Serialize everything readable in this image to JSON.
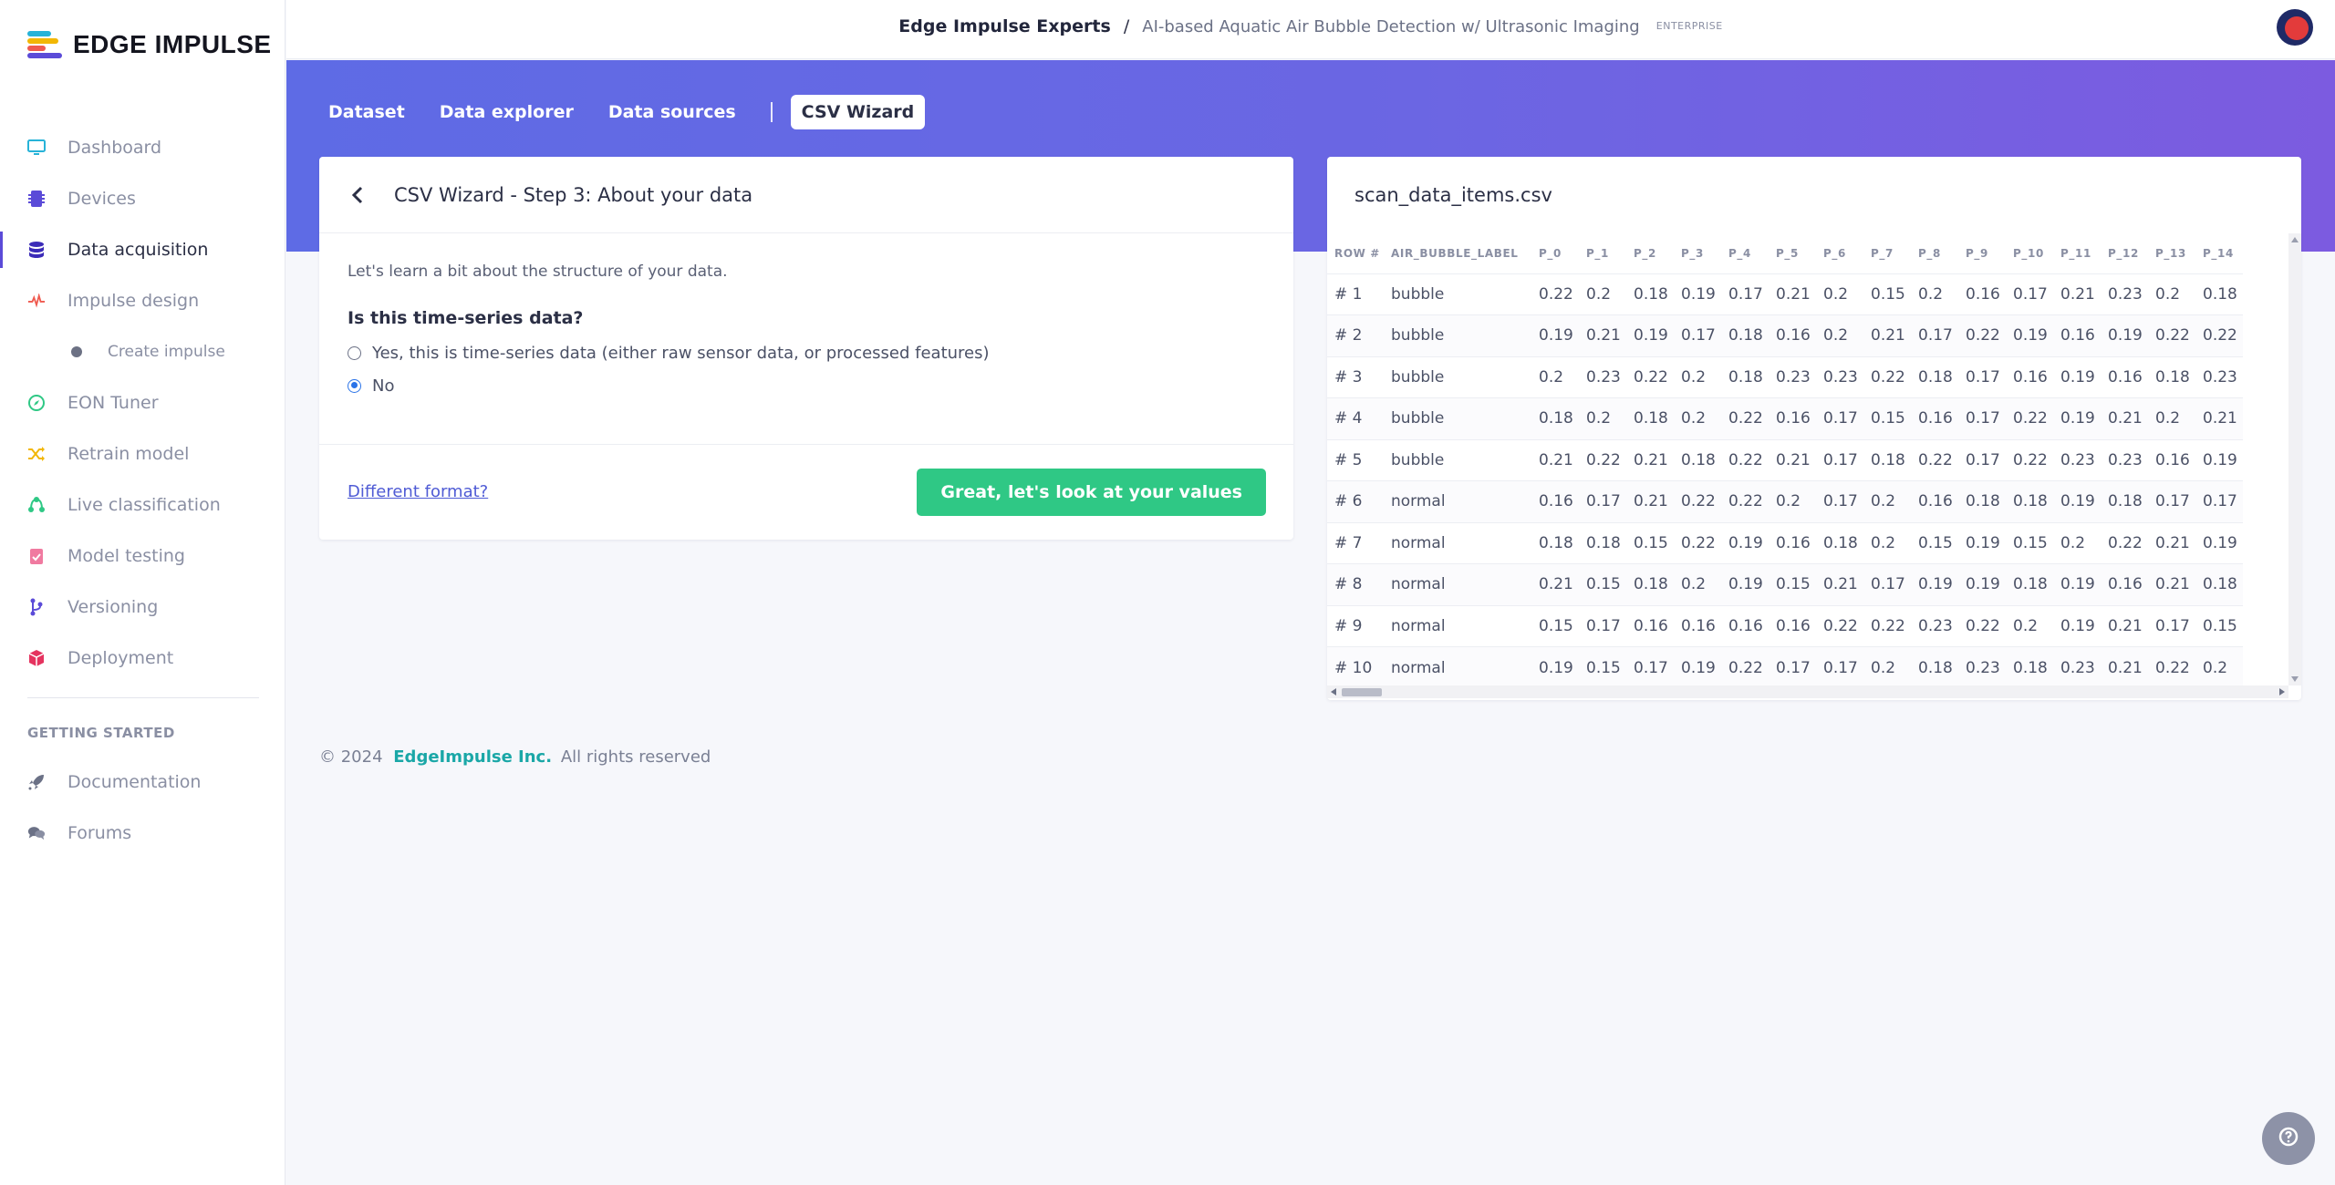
{
  "brand": {
    "name": "EDGE IMPULSE"
  },
  "sidebar": {
    "items": [
      {
        "label": "Dashboard",
        "icon": "monitor-icon",
        "color": "#27b3d8"
      },
      {
        "label": "Devices",
        "icon": "chip-icon",
        "color": "#5b4bd8"
      },
      {
        "label": "Data acquisition",
        "icon": "database-icon",
        "color": "#5b4bd8",
        "active": true
      },
      {
        "label": "Impulse design",
        "icon": "pulse-icon",
        "color": "#ef5a4f"
      },
      {
        "label": "EON Tuner",
        "icon": "compass-icon",
        "color": "#2fc885"
      },
      {
        "label": "Retrain model",
        "icon": "shuffle-icon",
        "color": "#f2b705"
      },
      {
        "label": "Live classification",
        "icon": "nodes-icon",
        "color": "#2fc885"
      },
      {
        "label": "Model testing",
        "icon": "clipboard-check-icon",
        "color": "#f07aa0"
      },
      {
        "label": "Versioning",
        "icon": "branch-icon",
        "color": "#5b4bd8"
      },
      {
        "label": "Deployment",
        "icon": "package-icon",
        "color": "#e5335f"
      }
    ],
    "sub_item": "Create impulse",
    "section_heading": "GETTING STARTED",
    "getting_started": [
      {
        "label": "Documentation",
        "icon": "rocket-icon"
      },
      {
        "label": "Forums",
        "icon": "chat-icon"
      }
    ]
  },
  "header": {
    "org": "Edge Impulse Experts",
    "separator": "/",
    "project": "AI-based Aquatic Air Bubble Detection w/ Ultrasonic Imaging",
    "badge": "ENTERPRISE"
  },
  "tabs": [
    "Dataset",
    "Data explorer",
    "Data sources",
    "CSV Wizard"
  ],
  "wizard": {
    "title": "CSV Wizard - Step 3: About your data",
    "intro": "Let's learn a bit about the structure of your data.",
    "question": "Is this time-series data?",
    "option_yes": "Yes, this is time-series data (either raw sensor data, or processed features)",
    "option_no": "No",
    "selected": "No",
    "different_format": "Different format?",
    "next_button": "Great, let's look at your values"
  },
  "preview": {
    "filename": "scan_data_items.csv",
    "columns": [
      "ROW #",
      "AIR_BUBBLE_LABEL",
      "P_0",
      "P_1",
      "P_2",
      "P_3",
      "P_4",
      "P_5",
      "P_6",
      "P_7",
      "P_8",
      "P_9",
      "P_10",
      "P_11",
      "P_12",
      "P_13",
      "P_14"
    ],
    "rows": [
      [
        "# 1",
        "bubble",
        "0.22",
        "0.2",
        "0.18",
        "0.19",
        "0.17",
        "0.21",
        "0.2",
        "0.15",
        "0.2",
        "0.16",
        "0.17",
        "0.21",
        "0.23",
        "0.2",
        "0.18"
      ],
      [
        "# 2",
        "bubble",
        "0.19",
        "0.21",
        "0.19",
        "0.17",
        "0.18",
        "0.16",
        "0.2",
        "0.21",
        "0.17",
        "0.22",
        "0.19",
        "0.16",
        "0.19",
        "0.22",
        "0.22"
      ],
      [
        "# 3",
        "bubble",
        "0.2",
        "0.23",
        "0.22",
        "0.2",
        "0.18",
        "0.23",
        "0.23",
        "0.22",
        "0.18",
        "0.17",
        "0.16",
        "0.19",
        "0.16",
        "0.18",
        "0.23"
      ],
      [
        "# 4",
        "bubble",
        "0.18",
        "0.2",
        "0.18",
        "0.2",
        "0.22",
        "0.16",
        "0.17",
        "0.15",
        "0.16",
        "0.17",
        "0.22",
        "0.19",
        "0.21",
        "0.2",
        "0.21"
      ],
      [
        "# 5",
        "bubble",
        "0.21",
        "0.22",
        "0.21",
        "0.18",
        "0.22",
        "0.21",
        "0.17",
        "0.18",
        "0.22",
        "0.17",
        "0.22",
        "0.23",
        "0.23",
        "0.16",
        "0.19"
      ],
      [
        "# 6",
        "normal",
        "0.16",
        "0.17",
        "0.21",
        "0.22",
        "0.22",
        "0.2",
        "0.17",
        "0.2",
        "0.16",
        "0.18",
        "0.18",
        "0.19",
        "0.18",
        "0.17",
        "0.17"
      ],
      [
        "# 7",
        "normal",
        "0.18",
        "0.18",
        "0.15",
        "0.22",
        "0.19",
        "0.16",
        "0.18",
        "0.2",
        "0.15",
        "0.19",
        "0.15",
        "0.2",
        "0.22",
        "0.21",
        "0.19"
      ],
      [
        "# 8",
        "normal",
        "0.21",
        "0.15",
        "0.18",
        "0.2",
        "0.19",
        "0.15",
        "0.21",
        "0.17",
        "0.19",
        "0.19",
        "0.18",
        "0.19",
        "0.16",
        "0.21",
        "0.18"
      ],
      [
        "# 9",
        "normal",
        "0.15",
        "0.17",
        "0.16",
        "0.16",
        "0.16",
        "0.16",
        "0.22",
        "0.22",
        "0.23",
        "0.22",
        "0.2",
        "0.19",
        "0.21",
        "0.17",
        "0.15"
      ],
      [
        "# 10",
        "normal",
        "0.19",
        "0.15",
        "0.17",
        "0.19",
        "0.22",
        "0.17",
        "0.17",
        "0.2",
        "0.18",
        "0.23",
        "0.18",
        "0.23",
        "0.21",
        "0.22",
        "0.2"
      ]
    ]
  },
  "footer": {
    "copyright": "© 2024",
    "company": "EdgeImpulse Inc.",
    "rights": "All rights reserved"
  },
  "colors": {
    "accent": "#5b4bd8",
    "primary_button": "#2fc885",
    "banner_start": "#5e6be5",
    "banner_end": "#7c5be0",
    "link": "#1aa7a7"
  }
}
